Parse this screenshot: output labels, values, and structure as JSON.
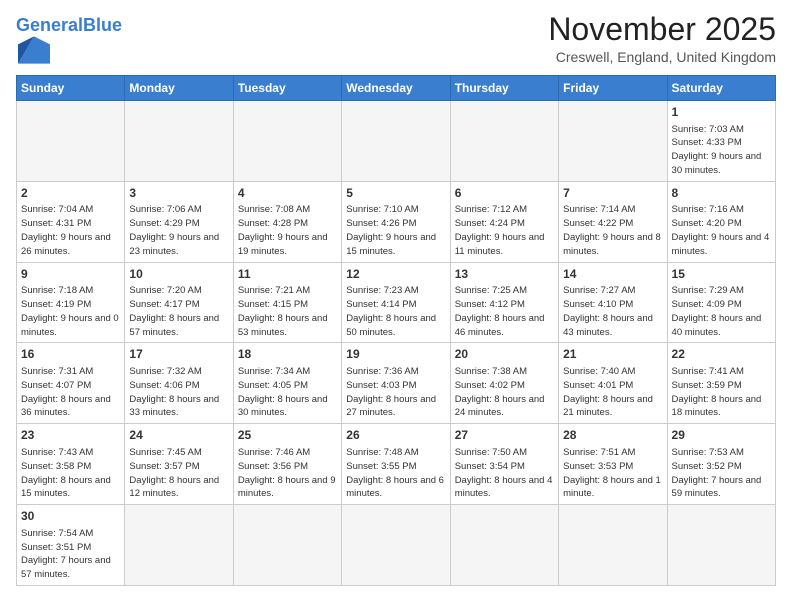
{
  "header": {
    "logo_general": "General",
    "logo_blue": "Blue",
    "month_title": "November 2025",
    "location": "Creswell, England, United Kingdom"
  },
  "weekdays": [
    "Sunday",
    "Monday",
    "Tuesday",
    "Wednesday",
    "Thursday",
    "Friday",
    "Saturday"
  ],
  "weeks": [
    [
      {
        "day": "",
        "info": ""
      },
      {
        "day": "",
        "info": ""
      },
      {
        "day": "",
        "info": ""
      },
      {
        "day": "",
        "info": ""
      },
      {
        "day": "",
        "info": ""
      },
      {
        "day": "",
        "info": ""
      },
      {
        "day": "1",
        "info": "Sunrise: 7:03 AM\nSunset: 4:33 PM\nDaylight: 9 hours\nand 30 minutes."
      }
    ],
    [
      {
        "day": "2",
        "info": "Sunrise: 7:04 AM\nSunset: 4:31 PM\nDaylight: 9 hours\nand 26 minutes."
      },
      {
        "day": "3",
        "info": "Sunrise: 7:06 AM\nSunset: 4:29 PM\nDaylight: 9 hours\nand 23 minutes."
      },
      {
        "day": "4",
        "info": "Sunrise: 7:08 AM\nSunset: 4:28 PM\nDaylight: 9 hours\nand 19 minutes."
      },
      {
        "day": "5",
        "info": "Sunrise: 7:10 AM\nSunset: 4:26 PM\nDaylight: 9 hours\nand 15 minutes."
      },
      {
        "day": "6",
        "info": "Sunrise: 7:12 AM\nSunset: 4:24 PM\nDaylight: 9 hours\nand 11 minutes."
      },
      {
        "day": "7",
        "info": "Sunrise: 7:14 AM\nSunset: 4:22 PM\nDaylight: 9 hours\nand 8 minutes."
      },
      {
        "day": "8",
        "info": "Sunrise: 7:16 AM\nSunset: 4:20 PM\nDaylight: 9 hours\nand 4 minutes."
      }
    ],
    [
      {
        "day": "9",
        "info": "Sunrise: 7:18 AM\nSunset: 4:19 PM\nDaylight: 9 hours\nand 0 minutes."
      },
      {
        "day": "10",
        "info": "Sunrise: 7:20 AM\nSunset: 4:17 PM\nDaylight: 8 hours\nand 57 minutes."
      },
      {
        "day": "11",
        "info": "Sunrise: 7:21 AM\nSunset: 4:15 PM\nDaylight: 8 hours\nand 53 minutes."
      },
      {
        "day": "12",
        "info": "Sunrise: 7:23 AM\nSunset: 4:14 PM\nDaylight: 8 hours\nand 50 minutes."
      },
      {
        "day": "13",
        "info": "Sunrise: 7:25 AM\nSunset: 4:12 PM\nDaylight: 8 hours\nand 46 minutes."
      },
      {
        "day": "14",
        "info": "Sunrise: 7:27 AM\nSunset: 4:10 PM\nDaylight: 8 hours\nand 43 minutes."
      },
      {
        "day": "15",
        "info": "Sunrise: 7:29 AM\nSunset: 4:09 PM\nDaylight: 8 hours\nand 40 minutes."
      }
    ],
    [
      {
        "day": "16",
        "info": "Sunrise: 7:31 AM\nSunset: 4:07 PM\nDaylight: 8 hours\nand 36 minutes."
      },
      {
        "day": "17",
        "info": "Sunrise: 7:32 AM\nSunset: 4:06 PM\nDaylight: 8 hours\nand 33 minutes."
      },
      {
        "day": "18",
        "info": "Sunrise: 7:34 AM\nSunset: 4:05 PM\nDaylight: 8 hours\nand 30 minutes."
      },
      {
        "day": "19",
        "info": "Sunrise: 7:36 AM\nSunset: 4:03 PM\nDaylight: 8 hours\nand 27 minutes."
      },
      {
        "day": "20",
        "info": "Sunrise: 7:38 AM\nSunset: 4:02 PM\nDaylight: 8 hours\nand 24 minutes."
      },
      {
        "day": "21",
        "info": "Sunrise: 7:40 AM\nSunset: 4:01 PM\nDaylight: 8 hours\nand 21 minutes."
      },
      {
        "day": "22",
        "info": "Sunrise: 7:41 AM\nSunset: 3:59 PM\nDaylight: 8 hours\nand 18 minutes."
      }
    ],
    [
      {
        "day": "23",
        "info": "Sunrise: 7:43 AM\nSunset: 3:58 PM\nDaylight: 8 hours\nand 15 minutes."
      },
      {
        "day": "24",
        "info": "Sunrise: 7:45 AM\nSunset: 3:57 PM\nDaylight: 8 hours\nand 12 minutes."
      },
      {
        "day": "25",
        "info": "Sunrise: 7:46 AM\nSunset: 3:56 PM\nDaylight: 8 hours\nand 9 minutes."
      },
      {
        "day": "26",
        "info": "Sunrise: 7:48 AM\nSunset: 3:55 PM\nDaylight: 8 hours\nand 6 minutes."
      },
      {
        "day": "27",
        "info": "Sunrise: 7:50 AM\nSunset: 3:54 PM\nDaylight: 8 hours\nand 4 minutes."
      },
      {
        "day": "28",
        "info": "Sunrise: 7:51 AM\nSunset: 3:53 PM\nDaylight: 8 hours\nand 1 minute."
      },
      {
        "day": "29",
        "info": "Sunrise: 7:53 AM\nSunset: 3:52 PM\nDaylight: 7 hours\nand 59 minutes."
      }
    ],
    [
      {
        "day": "30",
        "info": "Sunrise: 7:54 AM\nSunset: 3:51 PM\nDaylight: 7 hours\nand 57 minutes."
      },
      {
        "day": "",
        "info": ""
      },
      {
        "day": "",
        "info": ""
      },
      {
        "day": "",
        "info": ""
      },
      {
        "day": "",
        "info": ""
      },
      {
        "day": "",
        "info": ""
      },
      {
        "day": "",
        "info": ""
      }
    ]
  ]
}
